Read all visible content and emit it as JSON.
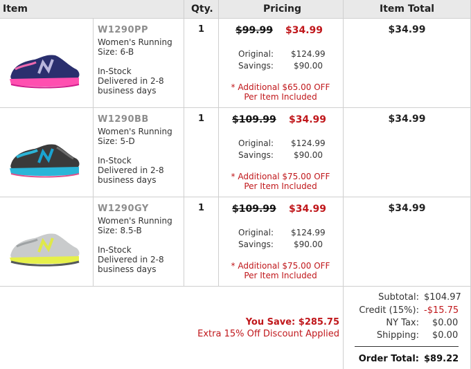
{
  "headers": {
    "item": "Item",
    "qty": "Qty.",
    "pricing": "Pricing",
    "total": "Item Total"
  },
  "pricing_labels": {
    "original": "Original:",
    "savings": "Savings:"
  },
  "items": [
    {
      "sku": "W1290PP",
      "desc": "Women's Running",
      "size": "Size: 6-B",
      "stock": "In-Stock",
      "delivery1": "Delivered in 2-8",
      "delivery2": "business days",
      "qty": "1",
      "old_price": "$99.99",
      "new_price": "$34.99",
      "original": "$124.99",
      "savings": "$90.00",
      "note1": "* Additional $65.00 OFF",
      "note2": "Per Item Included",
      "total": "$34.99"
    },
    {
      "sku": "W1290BB",
      "desc": "Women's Running",
      "size": "Size: 5-D",
      "stock": "In-Stock",
      "delivery1": "Delivered in 2-8",
      "delivery2": "business days",
      "qty": "1",
      "old_price": "$109.99",
      "new_price": "$34.99",
      "original": "$124.99",
      "savings": "$90.00",
      "note1": "* Additional $75.00 OFF",
      "note2": "Per Item Included",
      "total": "$34.99"
    },
    {
      "sku": "W1290GY",
      "desc": "Women's Running",
      "size": "Size: 8.5-B",
      "stock": "In-Stock",
      "delivery1": "Delivered in 2-8",
      "delivery2": "business days",
      "qty": "1",
      "old_price": "$109.99",
      "new_price": "$34.99",
      "original": "$124.99",
      "savings": "$90.00",
      "note1": "* Additional $75.00 OFF",
      "note2": "Per Item Included",
      "total": "$34.99"
    }
  ],
  "savings_summary": {
    "you_save": "You Save: $285.75",
    "extra": "Extra 15% Off Discount Applied"
  },
  "summary": {
    "subtotal_label": "Subtotal:",
    "subtotal": "$104.97",
    "credit_label": "Credit (15%):",
    "credit": "-$15.75",
    "tax_label": "NY Tax:",
    "tax": "$0.00",
    "shipping_label": "Shipping:",
    "shipping": "$0.00",
    "order_total_label": "Order Total:",
    "order_total": "$89.22"
  },
  "colors": {
    "accent_red": "#c0171b",
    "header_bg": "#e9e9e9",
    "grid": "#cfcfcf"
  }
}
